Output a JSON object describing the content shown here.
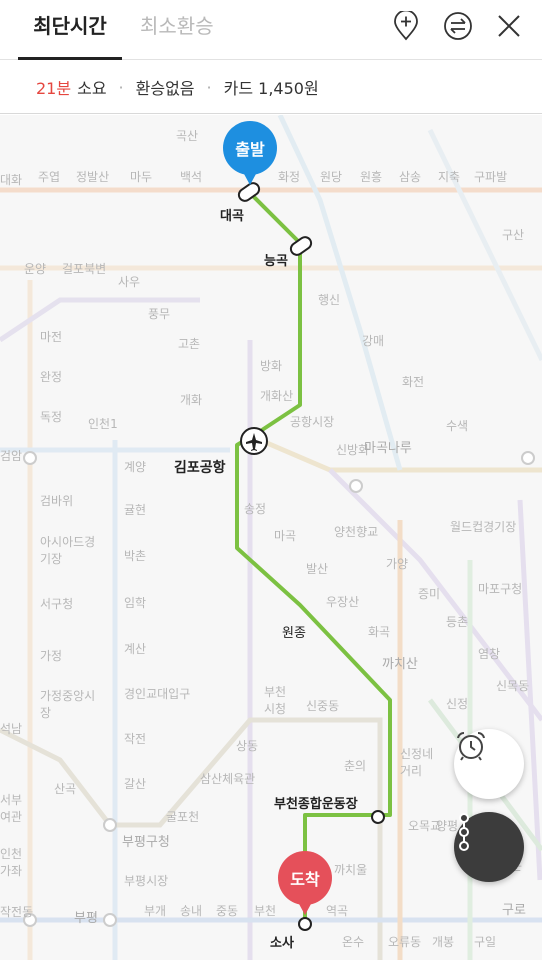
{
  "tabs": [
    {
      "label": "최단시간",
      "active": true
    },
    {
      "label": "최소환승",
      "active": false
    }
  ],
  "header_icons": [
    "add-waypoint-icon",
    "swap-icon",
    "close-icon"
  ],
  "summary": {
    "duration": "21분",
    "duration_suffix": "소요",
    "transfer": "환승없음",
    "fare": "카드 1,450원"
  },
  "route": {
    "color": "#7cc142",
    "start_pin": "출발",
    "end_pin": "도착",
    "stations": [
      "대곡",
      "능곡",
      "김포공항",
      "원종",
      "부천종합운동장",
      "소사"
    ]
  },
  "map_labels": [
    "곡산",
    "화정",
    "원당",
    "원흥",
    "삼송",
    "지축",
    "구파발",
    "주엽",
    "정발산",
    "마두",
    "백석",
    "구산",
    "운양",
    "걸포북변",
    "사우",
    "풍무",
    "고촌",
    "개화",
    "행신",
    "강매",
    "화전",
    "방화",
    "개화산",
    "공항시장",
    "신방화",
    "마곡나루",
    "수색",
    "마전",
    "완정",
    "독정",
    "인천1",
    "검암",
    "계양",
    "귤현",
    "박촌",
    "임학",
    "계산",
    "경인교대입구",
    "검바위",
    "아시아드경기장",
    "서구청",
    "가정",
    "가정중앙시장",
    "송정",
    "마곡",
    "양천향교",
    "발산",
    "우장산",
    "가양",
    "증미",
    "등촌",
    "화곡",
    "까치산",
    "염창",
    "신정",
    "양평",
    "부천시청",
    "신중동",
    "작전",
    "갈산",
    "삼산체육관",
    "상동",
    "춘의",
    "신정네거리",
    "부평구청",
    "굴포천",
    "산곡",
    "부평시장",
    "부평",
    "부개",
    "송내",
    "중동",
    "부천",
    "역곡",
    "온수",
    "오류동",
    "개봉",
    "구일",
    "구로",
    "까치울",
    "오목교",
    "마포구청",
    "월드컵경기장",
    "신목동",
    "석남",
    "서부여관",
    "인천가좌",
    "작전동",
    "백운",
    "대화"
  ],
  "colors": {
    "accent_red": "#e5463f",
    "start_pin": "#1e8fe0",
    "end_pin": "#e5505a"
  },
  "fabs": [
    "alarm-clock-icon",
    "route-steps-icon"
  ]
}
